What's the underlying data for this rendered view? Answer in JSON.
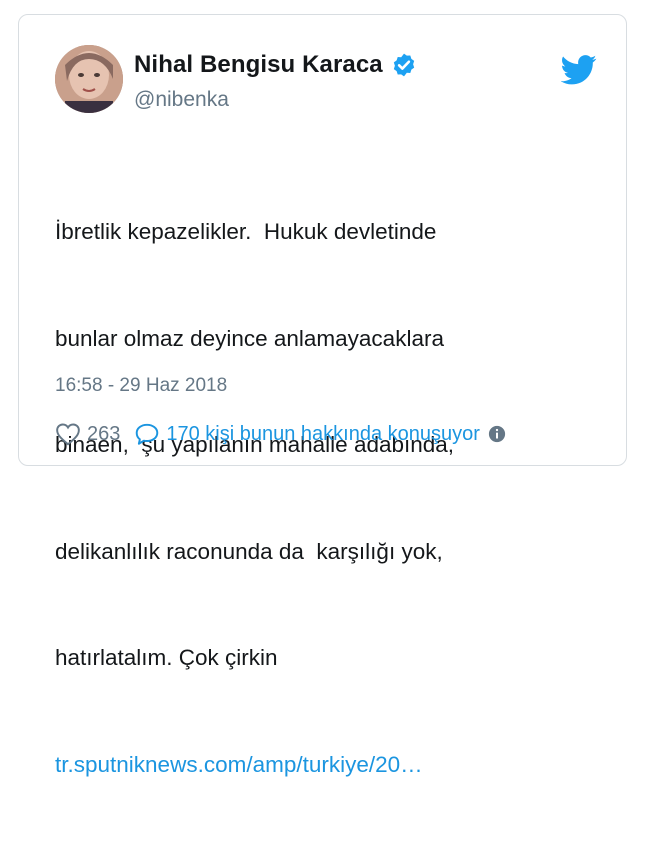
{
  "user": {
    "name": "Nihal Bengisu Karaca",
    "handle": "@nibenka"
  },
  "tweet": {
    "lines": [
      "İbretlik kepazelikler.  Hukuk devletinde",
      "bunlar olmaz deyince anlamayacaklara",
      "binaen,  şu yapılanın mahalle adabında,",
      "delikanlılık raconunda da  karşılığı yok,",
      "hatırlatalım. Çok çirkin"
    ],
    "link": "tr.sputniknews.com/amp/turkiye/20…",
    "timestamp": "16:58 - 29 Haz 2018"
  },
  "actions": {
    "like_count": "263",
    "talk_text": "170 kişi bunun hakkında konuşuyor"
  },
  "colors": {
    "accent": "#1b95e0",
    "secondary": "#657786",
    "verified": "#1da1f2",
    "bird": "#1da1f2"
  },
  "icons": [
    "verified-badge-icon",
    "twitter-bird-icon",
    "heart-icon",
    "speech-bubble-icon",
    "info-icon"
  ]
}
